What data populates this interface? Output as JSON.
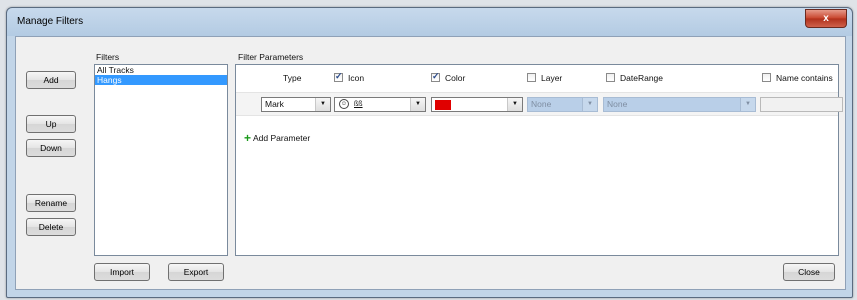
{
  "window": {
    "title": "Manage Filters",
    "close_glyph": "x"
  },
  "left_buttons": {
    "add": "Add",
    "up": "Up",
    "down": "Down",
    "rename": "Rename",
    "delete": "Delete"
  },
  "filters": {
    "label": "Filters",
    "items": [
      "All Tracks",
      "Hangs"
    ],
    "selected_index": 1
  },
  "bottom_buttons": {
    "import": "Import",
    "export": "Export",
    "close": "Close"
  },
  "params": {
    "label": "Filter Parameters",
    "columns": {
      "type": "Type",
      "icon": {
        "label": "Icon",
        "checked": true
      },
      "color": {
        "label": "Color",
        "checked": true
      },
      "layer": {
        "label": "Layer",
        "checked": false
      },
      "date_range": {
        "label": "DateRange",
        "checked": false
      },
      "name_contains": {
        "label": "Name contains",
        "checked": false
      }
    },
    "row": {
      "type_value": "Mark",
      "icon_value": "ßß",
      "color_value": "#e00000",
      "layer_value": "None",
      "date_range_value": "None",
      "name_contains_value": ""
    },
    "add_parameter": "Add Parameter"
  },
  "icons": {
    "combo_arrow": "▼",
    "add": "plus-icon",
    "smiley": "☺"
  }
}
